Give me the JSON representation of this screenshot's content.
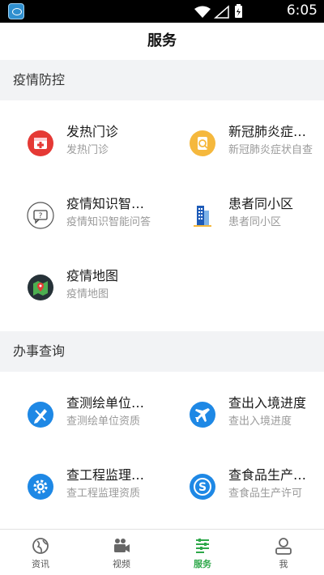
{
  "status_bar": {
    "time": "6:05"
  },
  "header": {
    "title": "服务"
  },
  "sections": [
    {
      "title": "疫情防控",
      "items": [
        {
          "title": "发热门诊",
          "subtitle": "发热门诊",
          "icon": "hospital-icon"
        },
        {
          "title": "新冠肺炎症状自查",
          "subtitle": "新冠肺炎症状自查",
          "icon": "symptom-check-icon"
        },
        {
          "title": "疫情知识智能问答",
          "subtitle": "疫情知识智能问答",
          "icon": "qa-icon"
        },
        {
          "title": "患者同小区",
          "subtitle": "患者同小区",
          "icon": "building-icon"
        },
        {
          "title": "疫情地图",
          "subtitle": "疫情地图",
          "icon": "map-icon"
        }
      ]
    },
    {
      "title": "办事查询",
      "items": [
        {
          "title": "查测绘单位资质",
          "subtitle": "查测绘单位资质",
          "icon": "survey-icon"
        },
        {
          "title": "查出入境进度",
          "subtitle": "查出入境进度",
          "icon": "airplane-icon"
        },
        {
          "title": "查工程监理资质",
          "subtitle": "查工程监理资质",
          "icon": "gear-icon"
        },
        {
          "title": "查食品生产许可",
          "subtitle": "查食品生产许可",
          "icon": "food-license-icon"
        }
      ]
    }
  ],
  "bottom_nav": [
    {
      "label": "资讯",
      "icon": "globe-icon"
    },
    {
      "label": "视频",
      "icon": "video-icon"
    },
    {
      "label": "服务",
      "icon": "service-icon",
      "active": true
    },
    {
      "label": "我",
      "icon": "user-icon"
    }
  ],
  "colors": {
    "accent": "#2ea84a",
    "section_bg": "#f2f3f5",
    "icon_blue": "#1e88e5"
  }
}
